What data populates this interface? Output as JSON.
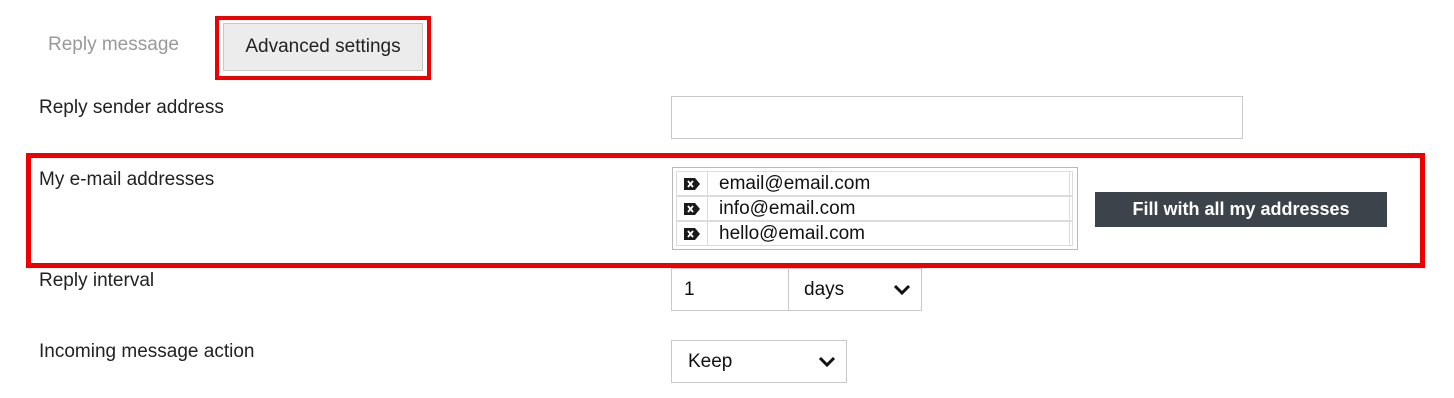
{
  "tabs": {
    "reply_message": "Reply message",
    "advanced_settings": "Advanced settings"
  },
  "form": {
    "reply_sender_label": "Reply sender address",
    "reply_sender_value": "",
    "my_emails_label": "My e-mail addresses",
    "emails": [
      "email@email.com",
      "info@email.com",
      "hello@email.com"
    ],
    "fill_button": "Fill with all my addresses",
    "reply_interval_label": "Reply interval",
    "reply_interval_value": "1",
    "reply_interval_unit": "days",
    "incoming_action_label": "Incoming message action",
    "incoming_action_value": "Keep"
  },
  "icons": {
    "email_remove": "delete-entry-icon",
    "select_arrow": "chevron-down-icon"
  },
  "colors": {
    "highlight": "#ee0000",
    "button_bg": "#3d434b",
    "active_tab_bg": "#ececec",
    "inactive_tab_text": "#999999"
  }
}
